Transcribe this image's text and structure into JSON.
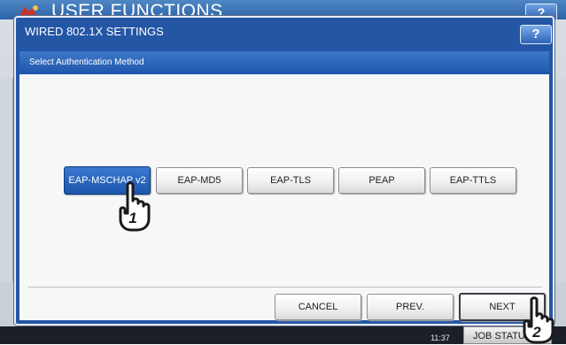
{
  "background": {
    "title": "USER FUNCTIONS",
    "help_label": "?",
    "clock_time": "11:37",
    "job_status_label": "JOB STATUS"
  },
  "dialog": {
    "title": "WIRED 802.1X SETTINGS",
    "help_label": "?",
    "instruction": "Select Authentication Method",
    "methods": [
      {
        "label": "EAP-MSCHAP v2",
        "selected": true
      },
      {
        "label": "EAP-MD5",
        "selected": false
      },
      {
        "label": "EAP-TLS",
        "selected": false
      },
      {
        "label": "PEAP",
        "selected": false
      },
      {
        "label": "EAP-TTLS",
        "selected": false
      }
    ],
    "buttons": {
      "cancel": "CANCEL",
      "prev": "PREV.",
      "next": "NEXT"
    }
  },
  "callouts": {
    "step1": "1",
    "step2": "2"
  },
  "colors": {
    "accent": "#2456a6",
    "selected": "#1d57ad"
  }
}
